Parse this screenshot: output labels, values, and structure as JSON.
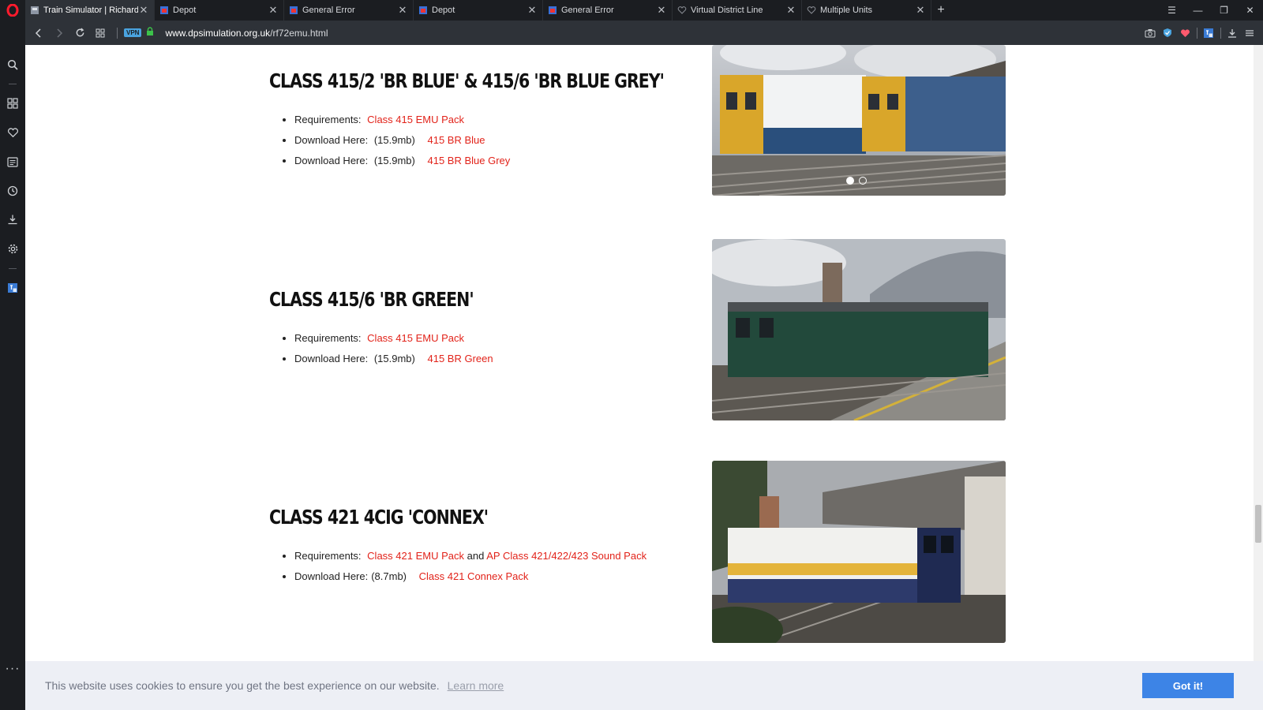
{
  "tabs": [
    {
      "title": "Train Simulator | Richard Fl",
      "active": true
    },
    {
      "title": "Depot",
      "active": false
    },
    {
      "title": "General Error",
      "active": false
    },
    {
      "title": "Depot",
      "active": false
    },
    {
      "title": "General Error",
      "active": false
    },
    {
      "title": "Virtual District Line",
      "active": false
    },
    {
      "title": "Multiple Units",
      "active": false
    }
  ],
  "address": {
    "vpn": "VPN",
    "url_domain": "www.dpsimulation.org.uk",
    "url_path": "/rf72emu.html"
  },
  "sections": [
    {
      "title": "CLASS 415/2 'BR BLUE' & 415/6 'BR BLUE GREY'",
      "items": [
        {
          "label": "Requirements:",
          "links": [
            "Class 415 EMU Pack"
          ]
        },
        {
          "label": "Download Here:",
          "size": "(15.9mb)",
          "links": [
            "415 BR Blue"
          ]
        },
        {
          "label": "Download Here:",
          "size": "(15.9mb)",
          "links": [
            "415 BR Blue Grey"
          ]
        }
      ]
    },
    {
      "title": "CLASS 415/6 'BR GREEN'",
      "items": [
        {
          "label": "Requirements:",
          "links": [
            "Class 415 EMU Pack"
          ]
        },
        {
          "label": "Download Here:",
          "size": "(15.9mb)",
          "links": [
            "415 BR Green"
          ]
        }
      ]
    },
    {
      "title": "CLASS 421 4CIG 'CONNEX'",
      "items": [
        {
          "label": "Requirements:",
          "links": [
            "Class 421 EMU Pack",
            "AP Class 421/422/423 Sound Pack"
          ],
          "joiner": "and"
        },
        {
          "label": "Download Here:",
          "size": "(8.7mb)",
          "links": [
            "Class 421 Connex Pack"
          ]
        }
      ]
    }
  ],
  "cookie": {
    "message": "This website uses cookies to ensure you get the best experience on our website.",
    "learn_more": "Learn more",
    "button": "Got it!"
  },
  "colors": {
    "link": "#e2231a",
    "accent": "#3d84e6",
    "chrome": "#1b1d21"
  }
}
